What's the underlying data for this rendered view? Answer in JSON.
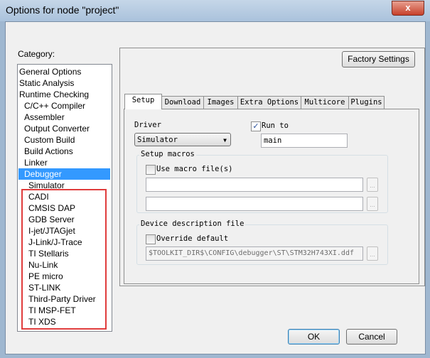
{
  "window": {
    "title": "Options for node \"project\"",
    "close": "x"
  },
  "category": {
    "label": "Category:",
    "items": [
      "General Options",
      "Static Analysis",
      "Runtime Checking",
      "C/C++ Compiler",
      "Assembler",
      "Output Converter",
      "Custom Build",
      "Build Actions",
      "Linker",
      "Debugger",
      "Simulator",
      "CADI",
      "CMSIS DAP",
      "GDB Server",
      "I-jet/JTAGjet",
      "J-Link/J-Trace",
      "TI Stellaris",
      "Nu-Link",
      "PE micro",
      "ST-LINK",
      "Third-Party Driver",
      "TI MSP-FET",
      "TI XDS"
    ],
    "selected": "Debugger",
    "highlight_color": "#e03c3c"
  },
  "factory_settings": "Factory Settings",
  "tabs": [
    "Setup",
    "Download",
    "Images",
    "Extra Options",
    "Multicore",
    "Plugins"
  ],
  "setup": {
    "driver_label": "Driver",
    "driver_value": "Simulator",
    "run_to_label": "Run to",
    "run_to_checked": true,
    "run_to_value": "main",
    "macros_group": "Setup macros",
    "use_macro_label": "Use macro file(s)",
    "use_macro_checked": false,
    "macro1": "",
    "macro2": "",
    "browse": "...",
    "ddf_group": "Device description file",
    "override_label": "Override default",
    "override_checked": false,
    "ddf_path": "$TOOLKIT_DIR$\\CONFIG\\debugger\\ST\\STM32H743XI.ddf"
  },
  "buttons": {
    "ok": "OK",
    "cancel": "Cancel"
  }
}
